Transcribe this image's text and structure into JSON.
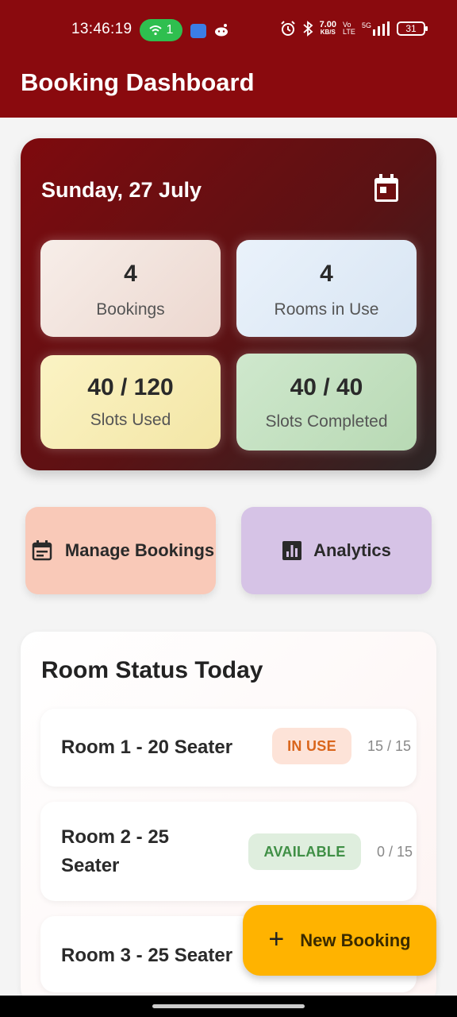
{
  "status_bar": {
    "time": "13:46:19",
    "hotspot_count": "1",
    "net_speed_value": "7.00",
    "net_speed_unit": "KB/S",
    "volte": "Vo LTE",
    "network": "5G",
    "battery": "31"
  },
  "app_bar": {
    "title": "Booking Dashboard"
  },
  "summary": {
    "date": "Sunday, 27 July",
    "stats": [
      {
        "value": "4",
        "label": "Bookings"
      },
      {
        "value": "4",
        "label": "Rooms in Use"
      },
      {
        "value": "40 / 120",
        "label": "Slots Used"
      },
      {
        "value": "40 / 40",
        "label": "Slots Completed"
      }
    ]
  },
  "actions": {
    "manage_label": "Manage Bookings",
    "analytics_label": "Analytics"
  },
  "room_status": {
    "title": "Room Status Today",
    "rooms": [
      {
        "name": "Room 1 - 20 Seater",
        "status": "IN USE",
        "capacity": "15 / 15"
      },
      {
        "name": "Room 2 - 25 Seater",
        "status": "AVAILABLE",
        "capacity": "0 / 15"
      },
      {
        "name": "Room 3 - 25 Seater"
      }
    ]
  },
  "fab": {
    "label": "New Booking",
    "icon": "+"
  },
  "colors": {
    "primary": "#8a0a0e",
    "in_use": "#d9651b",
    "available": "#3f8f45",
    "fab": "#ffb300"
  }
}
